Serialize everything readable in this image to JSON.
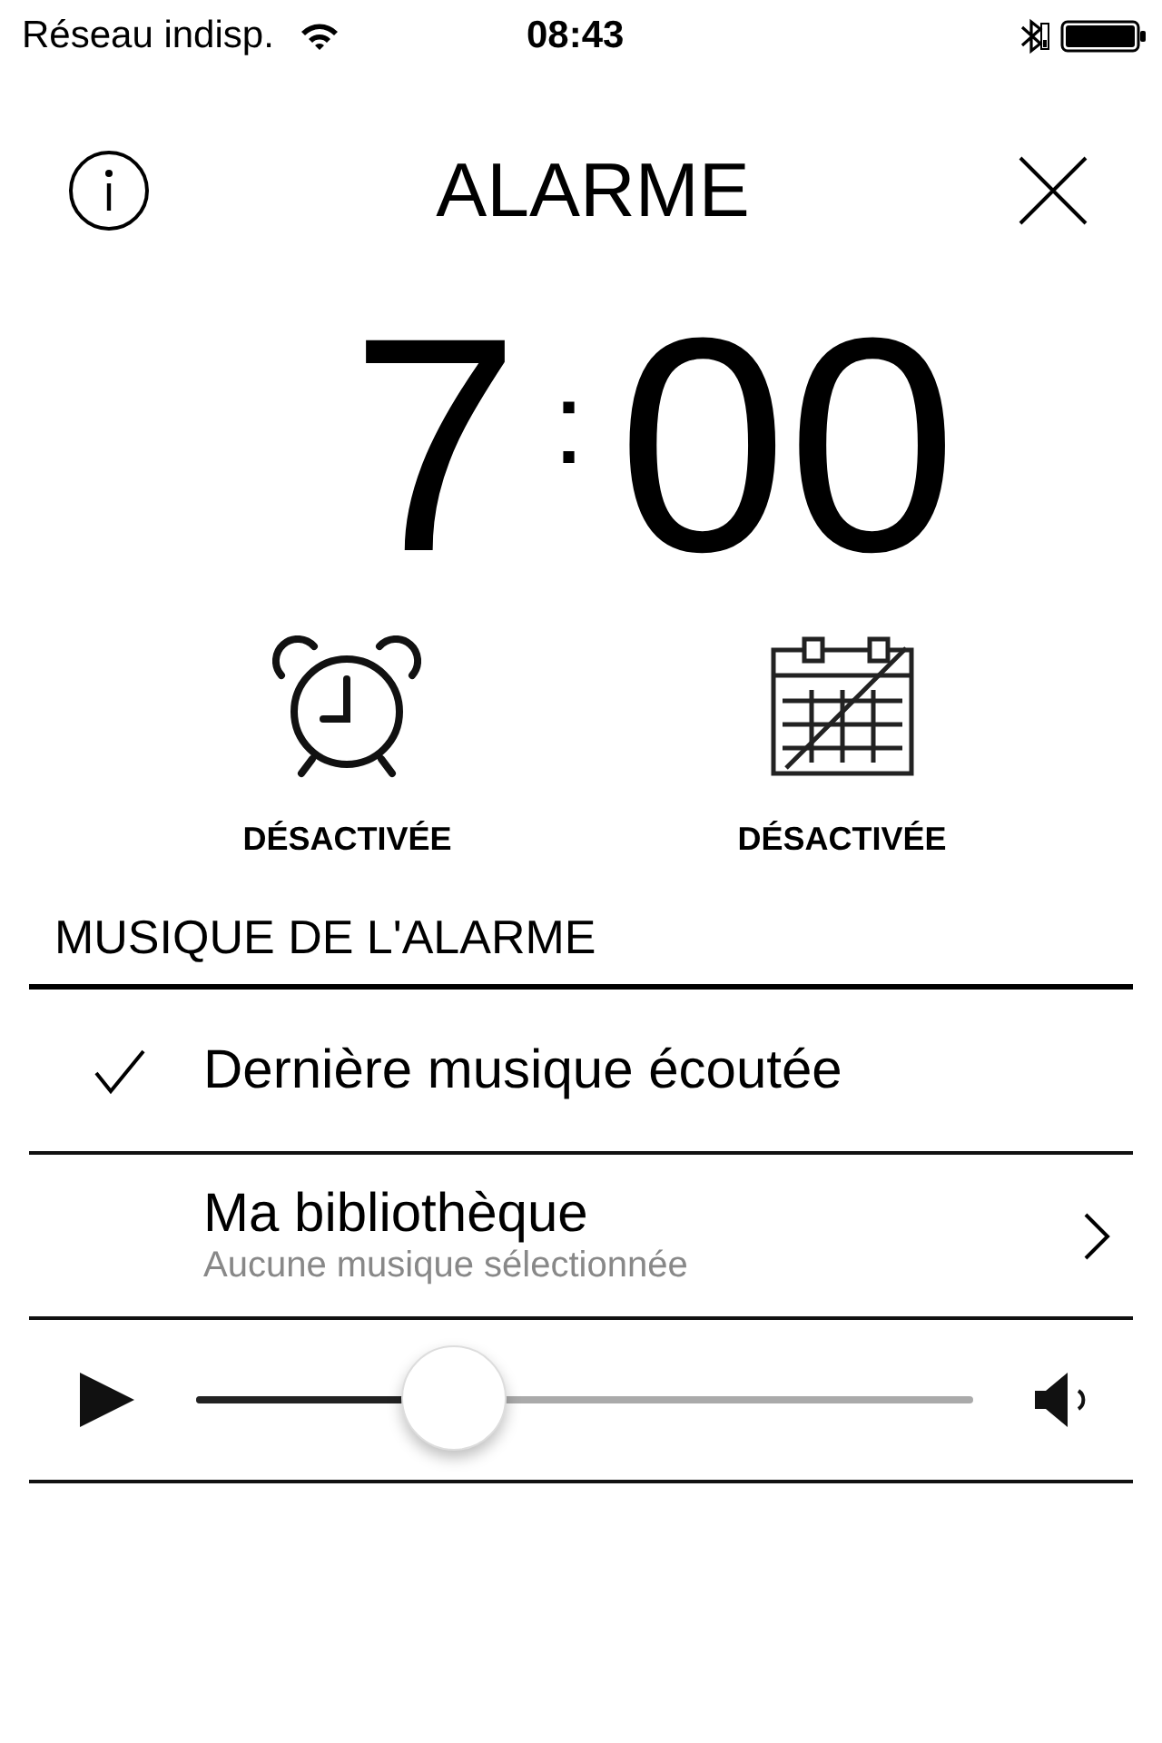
{
  "status_bar": {
    "carrier": "Réseau indisp.",
    "time": "08:43"
  },
  "header": {
    "title": "ALARME"
  },
  "alarm_time": {
    "hours": "7",
    "separator": ":",
    "minutes": "00"
  },
  "toggles": [
    {
      "kind": "alarm",
      "label": "DÉSACTIVÉE"
    },
    {
      "kind": "repeat",
      "label": "DÉSACTIVÉE"
    }
  ],
  "section_title": "MUSIQUE DE L'ALARME",
  "music_options": [
    {
      "kind": "choice",
      "title": "Dernière musique écoutée",
      "selected": true
    },
    {
      "kind": "link",
      "title": "Ma bibliothèque",
      "subtitle": "Aucune musique sélectionnée",
      "selected": false
    }
  ],
  "player": {
    "level": 0.33
  }
}
